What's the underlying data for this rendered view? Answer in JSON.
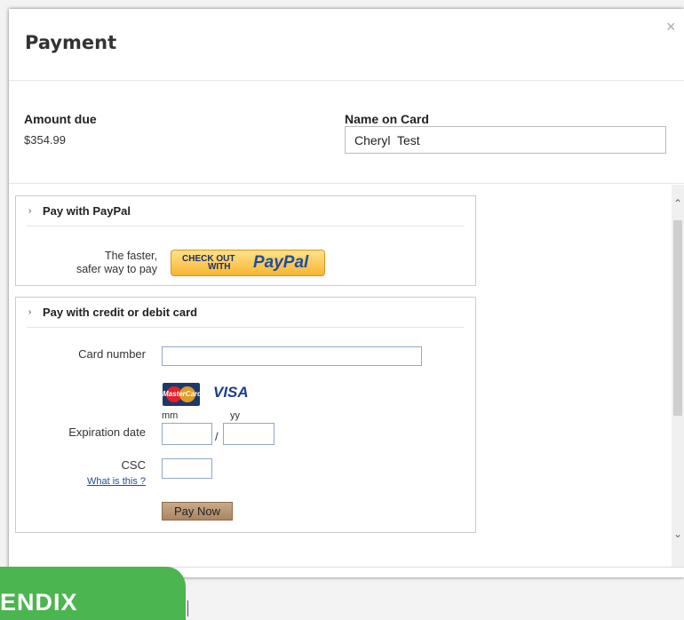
{
  "dialog": {
    "title": "Payment",
    "close_label": "×"
  },
  "summary": {
    "amount_label": "Amount due",
    "amount_value": "$354.99",
    "name_label": "Name on Card",
    "name_value": "Cheryl  Test"
  },
  "paypal": {
    "section_title": "Pay with PayPal",
    "tagline_line1": "The faster,",
    "tagline_line2": "safer way to pay",
    "button_small_line1": "CHECK OUT",
    "button_small_line2": "WITH",
    "button_brand": "PayPal"
  },
  "card": {
    "section_title": "Pay with credit or debit card",
    "card_number_label": "Card number",
    "card_number_value": "",
    "brands": {
      "mastercard": "MasterCard",
      "visa": "VISA"
    },
    "mm_label": "mm",
    "yy_label": "yy",
    "expiration_label": "Expiration date",
    "separator": "/",
    "csc_label": "CSC",
    "csc_help_link": "What is this ?",
    "pay_button": "Pay Now"
  },
  "scrollbar": {
    "up_arrow": "⌃",
    "down_arrow": "⌄"
  },
  "banner": {
    "text": "ENDIX"
  },
  "colors": {
    "banner_green": "#4bb54f",
    "paypal_button": "#f7b531",
    "pay_now_button": "#b8966f",
    "link_blue": "#1d4f91"
  }
}
